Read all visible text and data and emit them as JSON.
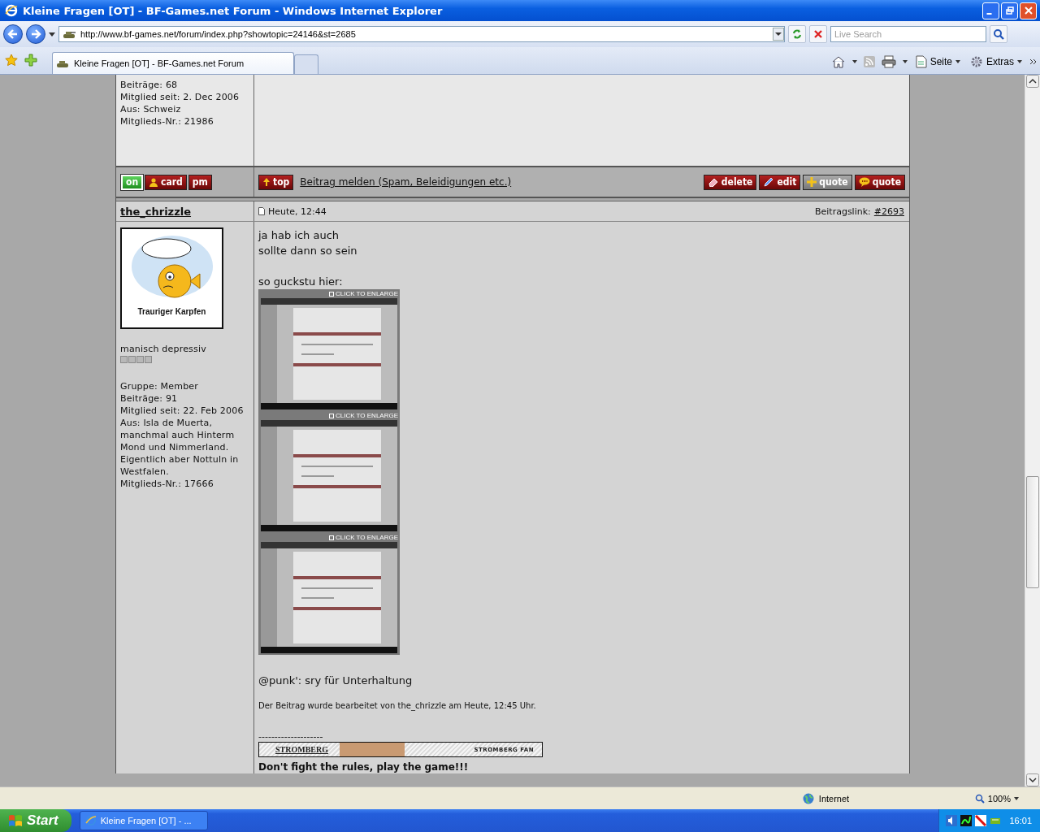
{
  "window": {
    "title": "Kleine Fragen [OT] - BF-Games.net Forum - Windows Internet Explorer"
  },
  "address_bar": {
    "url": "http://www.bf-games.net/forum/index.php?showtopic=24146&st=2685"
  },
  "search": {
    "placeholder": "Live Search"
  },
  "tabs": [
    {
      "label": "Kleine Fragen [OT] - BF-Games.net Forum",
      "selected": true
    }
  ],
  "command_bar": [
    {
      "label": "Seite",
      "kind": "page"
    },
    {
      "label": "Extras",
      "kind": "tools"
    }
  ],
  "previous_post": {
    "profile": [
      "Beiträge: 68",
      "Mitglied seit: 2. Dec 2006",
      "Aus: Schweiz",
      "Mitglieds-Nr.: 21986"
    ],
    "actions": {
      "status": {
        "label": "on",
        "online": true
      },
      "profile_buttons": [
        {
          "label": "card",
          "kind": "card"
        },
        {
          "label": "pm",
          "kind": "pm"
        }
      ],
      "top_button": "top",
      "report_link": "Beitrag melden (Spam, Beleidigungen etc.)",
      "post_buttons": [
        {
          "label": "delete",
          "kind": "delete"
        },
        {
          "label": "edit",
          "kind": "edit"
        },
        {
          "label": "quote",
          "kind": "multiquote"
        },
        {
          "label": "quote",
          "kind": "quote"
        }
      ]
    }
  },
  "post": {
    "author": "the_chrizzle",
    "date": "Heute, 12:44",
    "link_label": "Beitragslink:",
    "link": "#2693",
    "avatar_caption": "Trauriger Karpfen",
    "rank": "manisch depressiv",
    "profile": [
      "Gruppe: Member",
      "Beiträge: 91",
      "Mitglied seit: 22. Feb 2006",
      "Aus: Isla de Muerta, manchmal auch Hinterm Mond und Nimmerland. Eigentlich aber Nottuln in Westfalen.",
      "Mitglieds-Nr.: 17666"
    ],
    "body": [
      {
        "kind": "text",
        "lines": [
          "ja hab ich auch",
          "sollte dann so sein"
        ]
      },
      {
        "kind": "text",
        "lines": [
          "so guckstu hier:"
        ]
      },
      {
        "kind": "thumbnails",
        "captions": [
          "CLICK TO ENLARGE",
          "CLICK TO ENLARGE",
          "CLICK TO ENLARGE"
        ]
      },
      {
        "kind": "text",
        "lines": [
          "@punk': sry für Unterhaltung"
        ]
      }
    ],
    "edit_note": "Der Beitrag wurde bearbeitet von the_chrizzle am Heute, 12:45 Uhr.",
    "signature": {
      "separator": "--------------------",
      "banner_title": "STROMBERG",
      "banner_tag": "STROMBERG FAN",
      "text": "Don't fight the rules, play the game!!!"
    }
  },
  "status_bar": {
    "zone": "Internet",
    "zoom": "100%"
  },
  "taskbar": {
    "start": "Start",
    "tasks": [
      {
        "label": "Kleine Fragen [OT] - ...",
        "selected": false
      }
    ],
    "clock": "16:01"
  }
}
